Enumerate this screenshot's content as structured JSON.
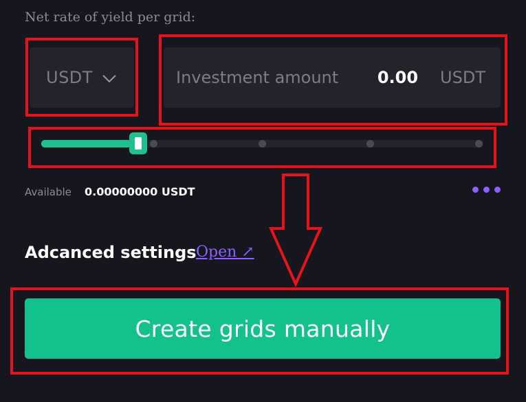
{
  "header": {
    "net_rate_label": "Net rate of yield per grid:"
  },
  "currency_select": {
    "selected": "USDT",
    "icon": "chevron-down-icon"
  },
  "investment": {
    "placeholder": "Investment amount",
    "value": "0.00",
    "unit": "USDT"
  },
  "slider": {
    "value_fraction": 0.2,
    "stops": [
      0,
      0.25,
      0.5,
      0.75,
      1.0
    ]
  },
  "balance": {
    "label": "Available",
    "value": "0.00000000 USDT",
    "more_icon": "more-dots-icon"
  },
  "advanced": {
    "label": "Adcanced settings",
    "link": "Open ↗"
  },
  "action": {
    "create_label": "Create grids manually"
  },
  "colors": {
    "background": "#16161e",
    "field": "#23232c",
    "accent_green": "#13c18d",
    "accent_purple": "#8d60ff",
    "annotation_red": "#e8131a"
  }
}
